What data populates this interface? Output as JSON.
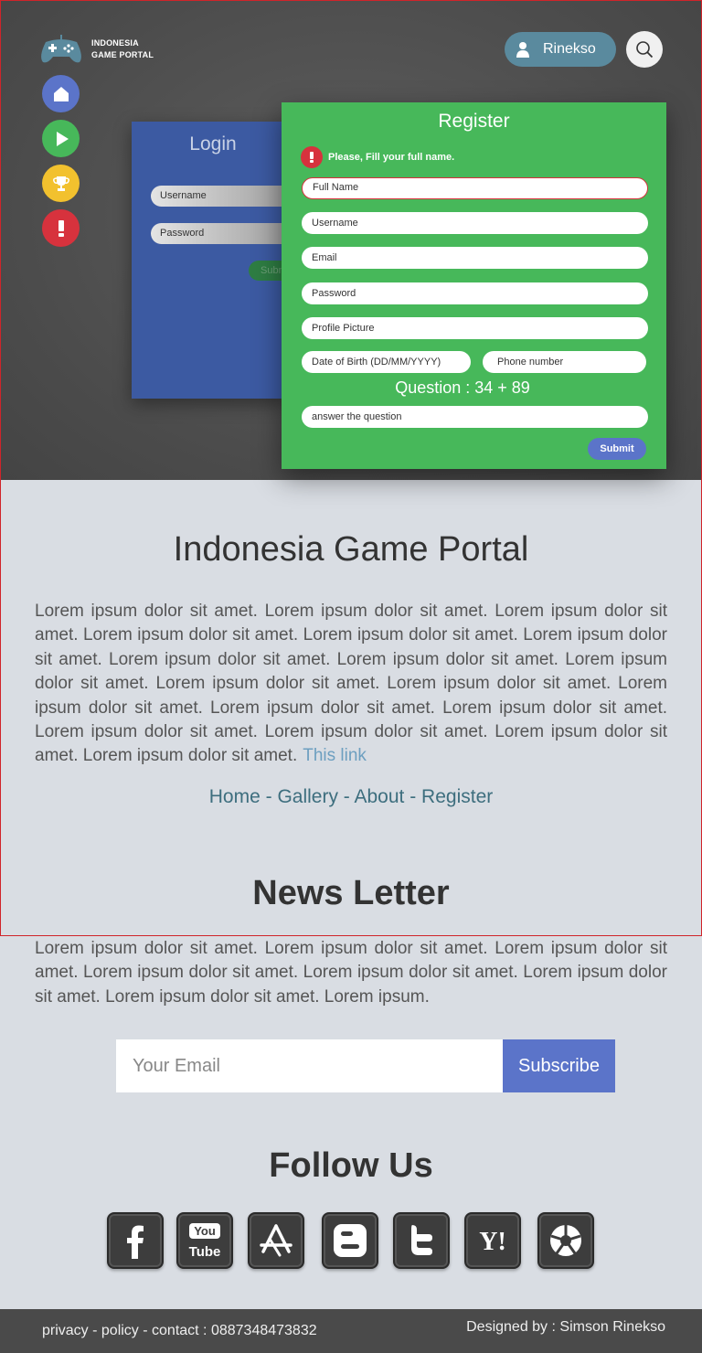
{
  "brand": {
    "line1": "INDONESIA",
    "line2": "GAME PORTAL",
    "logo_icon": "gamepad-icon"
  },
  "colors": {
    "home": "#5b74c9",
    "play": "#47b85a",
    "trophy": "#f2c12e",
    "alert": "#d7323d",
    "register_bg": "#47b85a",
    "login_bg": "#3c5aa2",
    "subscribe": "#5b74c9"
  },
  "side_nav": [
    {
      "name": "home",
      "icon": "home-icon"
    },
    {
      "name": "play",
      "icon": "play-icon"
    },
    {
      "name": "trophy",
      "icon": "trophy-icon"
    },
    {
      "name": "alert",
      "icon": "alert-icon"
    }
  ],
  "user": {
    "name": "Rinekso",
    "icon": "user-icon"
  },
  "search": {
    "icon": "search-icon"
  },
  "login": {
    "title": "Login",
    "username_placeholder": "Username",
    "password_placeholder": "Password",
    "submit_label": "Submit"
  },
  "register": {
    "title": "Register",
    "error": "Please, Fill your full name.",
    "fields": {
      "full_name": "Full Name",
      "username": "Username",
      "email": "Email",
      "password": "Password",
      "profile_picture": "Profile Picture",
      "dob": "Date of Birth  (DD/MM/YYYY)",
      "phone": "Phone number",
      "answer": "answer the question"
    },
    "question": "Question : 34 + 89",
    "submit_label": "Submit"
  },
  "main": {
    "title": "Indonesia Game Portal",
    "intro": "Lorem ipsum dolor sit amet. Lorem ipsum dolor sit amet. Lorem ipsum dolor sit amet. Lorem ipsum dolor sit amet. Lorem ipsum dolor sit amet. Lorem ipsum dolor sit amet. Lorem ipsum dolor sit amet. Lorem ipsum dolor sit amet. Lorem ipsum dolor sit amet. Lorem ipsum dolor sit amet. Lorem ipsum dolor sit amet. Lorem ipsum dolor sit amet. Lorem ipsum dolor sit amet. Lorem ipsum dolor sit amet. Lorem ipsum dolor sit amet. Lorem ipsum dolor sit amet. Lorem ipsum dolor sit amet. Lorem ipsum dolor sit amet.",
    "link_text": "This link"
  },
  "nav_links": {
    "home": "Home",
    "gallery": "Gallery",
    "about": "About",
    "register": "Register",
    "separator": " - "
  },
  "newsletter": {
    "title": "News Letter",
    "text": "Lorem ipsum dolor sit amet. Lorem ipsum dolor sit amet. Lorem ipsum dolor sit amet. Lorem ipsum dolor sit amet. Lorem ipsum dolor sit amet. Lorem ipsum dolor sit amet. Lorem ipsum dolor sit amet. Lorem ipsum.",
    "email_placeholder": "Your Email",
    "subscribe_label": "Subscribe"
  },
  "follow": {
    "title": "Follow Us",
    "icons": [
      "facebook-icon",
      "youtube-icon",
      "app-store-icon",
      "blogger-icon",
      "twitter-icon",
      "yahoo-icon",
      "picasa-icon"
    ],
    "youtube_text_1": "You",
    "youtube_text_2": "Tube",
    "yahoo_text": "Y!"
  },
  "footer": {
    "left": "privacy - policy - contact : 0887348473832",
    "right": "Designed by : Simson Rinekso"
  }
}
